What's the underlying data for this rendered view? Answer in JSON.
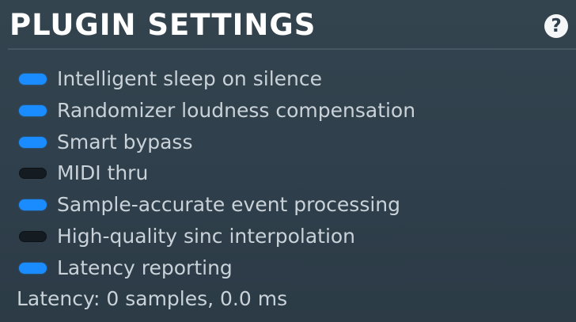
{
  "header": {
    "title": "PLUGIN SETTINGS",
    "help_icon": "question-mark-icon",
    "help_label": "?"
  },
  "options": [
    {
      "label": "Intelligent sleep on silence",
      "enabled": true
    },
    {
      "label": "Randomizer loudness compensation",
      "enabled": true
    },
    {
      "label": "Smart bypass",
      "enabled": true
    },
    {
      "label": "MIDI thru",
      "enabled": false
    },
    {
      "label": "Sample-accurate event processing",
      "enabled": true
    },
    {
      "label": "High-quality sinc interpolation",
      "enabled": false
    },
    {
      "label": "Latency reporting",
      "enabled": true
    }
  ],
  "status": {
    "latency_text": "Latency: 0 samples, 0.0 ms"
  },
  "colors": {
    "background": "#2f3f4c",
    "toggle_on": "#1a8cff",
    "toggle_off": "#141c22",
    "label": "#c9d2d8",
    "title": "#ffffff"
  }
}
